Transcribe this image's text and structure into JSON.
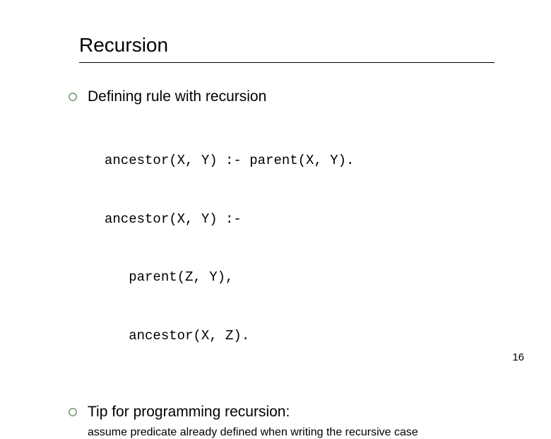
{
  "slide": {
    "title": "Recursion",
    "bullets": [
      {
        "text": "Defining rule with recursion"
      },
      {
        "text": "Tip for programming recursion:"
      }
    ],
    "code": {
      "l1": "ancestor(X, Y) :- parent(X, Y).",
      "l2": "ancestor(X, Y) :-",
      "l3": "   parent(Z, Y),",
      "l4": "   ancestor(X, Z)."
    },
    "subnote": "assume predicate already defined when writing the recursive case",
    "page_number": "16"
  }
}
